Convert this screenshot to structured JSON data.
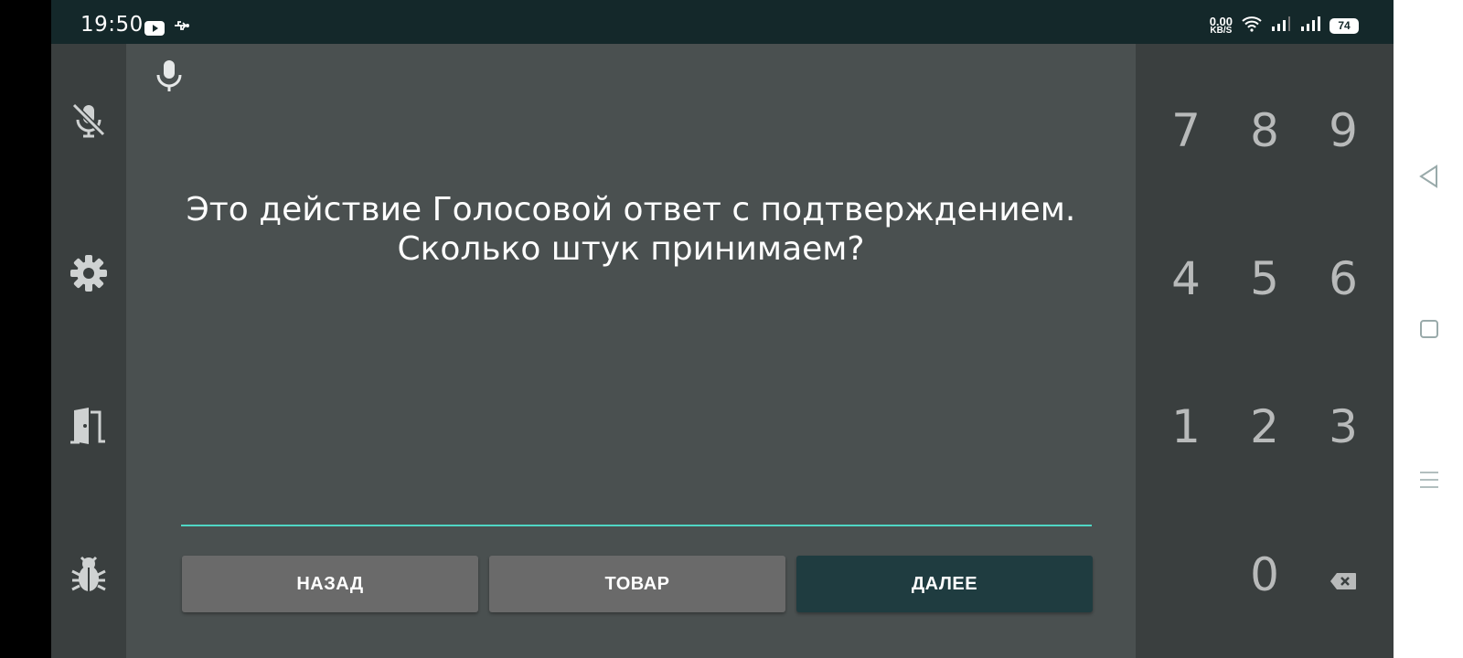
{
  "status": {
    "time": "19:50",
    "left_icons": [
      "youtube-icon",
      "usb-icon"
    ],
    "net_speed": "0.00",
    "net_unit": "KB/S",
    "battery": "74"
  },
  "rail": [
    "mic-off-icon",
    "gear-icon",
    "exit-door-icon",
    "bug-icon"
  ],
  "prompt": {
    "line1": "Это действие Голосовой ответ с подтверждением.",
    "line2": "Сколько штук принимаем?"
  },
  "input": {
    "value": "",
    "accent": "#4fd6c4"
  },
  "buttons": {
    "back": "НАЗАД",
    "item": "ТОВАР",
    "next": "ДАЛЕЕ"
  },
  "keypad": {
    "k7": "7",
    "k8": "8",
    "k9": "9",
    "k4": "4",
    "k5": "5",
    "k6": "6",
    "k1": "1",
    "k2": "2",
    "k3": "3",
    "k0": "0",
    "backspace_icon": "backspace-icon"
  },
  "colors": {
    "status_bar": "#14282a",
    "main_bg": "#4a5050",
    "rail_bg": "#3a3f3f",
    "button_grey": "#6a6a6a",
    "button_primary": "#1f3c40"
  },
  "navbar": [
    "back-triangle-icon",
    "home-square-icon",
    "menu-lines-icon"
  ]
}
